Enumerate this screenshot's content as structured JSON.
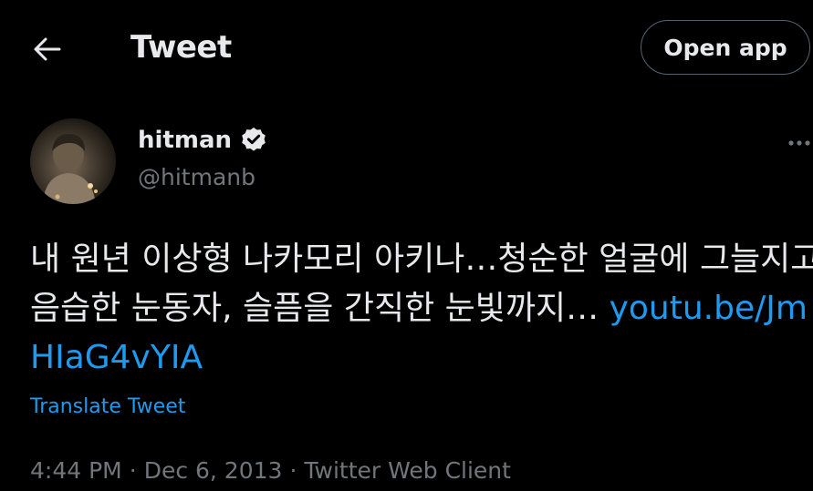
{
  "header": {
    "back_icon": "arrow-left-icon",
    "title": "Tweet",
    "open_app_label": "Open app"
  },
  "author": {
    "display_name": "hitman",
    "handle": "@hitmanb",
    "verified": true,
    "verified_icon": "verified-badge-icon"
  },
  "more_icon": "more-dots-icon",
  "tweet": {
    "text": "내 원년 이상형 나카모리 아키나…청순한 얼굴에 그늘지고 음습한 눈동자, 슬픔을 간직한 눈빛까지… ",
    "link_text": "youtu.be/JmHIaG4vYIA",
    "translate_label": "Translate Tweet"
  },
  "meta": {
    "time": "4:44 PM",
    "date": "Dec 6, 2013",
    "client": "Twitter Web Client",
    "separator": "·"
  },
  "colors": {
    "background": "#000000",
    "text": "#e7e9ea",
    "secondary": "#71767b",
    "link": "#1d9bf0",
    "border": "#536471"
  }
}
